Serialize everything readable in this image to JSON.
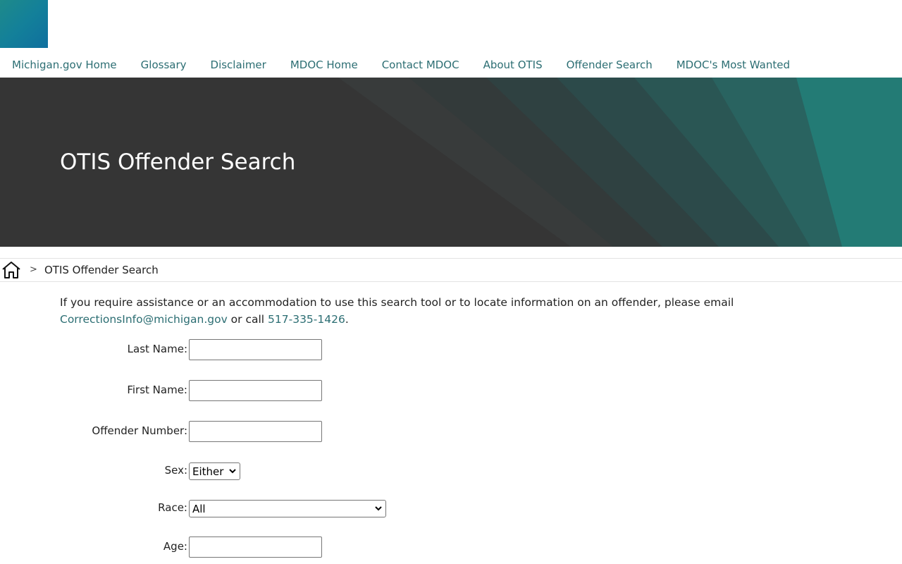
{
  "nav": {
    "items": [
      {
        "label": "Michigan.gov Home"
      },
      {
        "label": "Glossary"
      },
      {
        "label": "Disclaimer"
      },
      {
        "label": "MDOC Home"
      },
      {
        "label": "Contact MDOC"
      },
      {
        "label": "About OTIS"
      },
      {
        "label": "Offender Search"
      },
      {
        "label": "MDOC's Most Wanted"
      }
    ]
  },
  "hero": {
    "title": "OTIS Offender Search"
  },
  "breadcrumb": {
    "home_icon": "home-icon",
    "separator": ">",
    "current": "OTIS Offender Search"
  },
  "assistance": {
    "text_before": "If you require assistance or an accommodation to use this search tool or to locate information on an offender, please email ",
    "email": "CorrectionsInfo@michigan.gov",
    "text_middle": " or call ",
    "phone": "517-335-1426",
    "text_after": "."
  },
  "form": {
    "last_name": {
      "label": "Last Name:",
      "value": ""
    },
    "first_name": {
      "label": "First Name:",
      "value": ""
    },
    "offender_number": {
      "label": "Offender Number:",
      "value": ""
    },
    "sex": {
      "label": "Sex:",
      "selected": "Either"
    },
    "race": {
      "label": "Race:",
      "selected": "All"
    },
    "age": {
      "label": "Age:",
      "value": ""
    }
  },
  "colors": {
    "link": "#2c6e73",
    "hero_dark": "#353535",
    "hero_teal": "#237b75"
  }
}
